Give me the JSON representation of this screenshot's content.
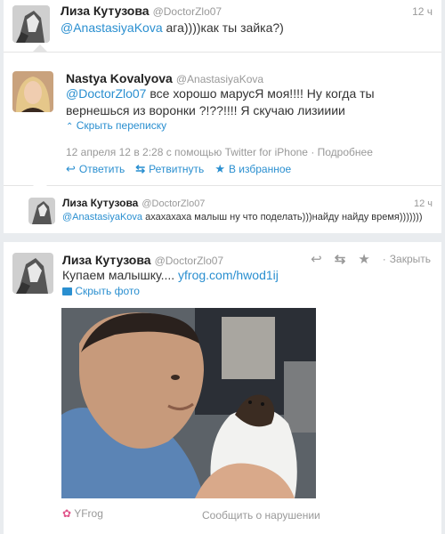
{
  "tweet1": {
    "name": "Лиза Кутузова",
    "handle": "@DoctorZlo07",
    "time": "12 ч",
    "mention": "@AnastasiyaKova",
    "text": " ага))))как ты зайка?)"
  },
  "tweet2": {
    "name": "Nastya Kovalyova",
    "handle": "@AnastasiyaKova",
    "mention": "@DoctorZlo07",
    "text": " все хорошо марусЯ моя!!!! Ну когда ты вернешься из воронки ?!??!!!! Я скучаю лизииии",
    "hide_conversation": "Скрыть переписку",
    "meta": "12 апреля 12 в 2:28 с помощью Twitter for iPhone · Подробнее",
    "reply": "Ответить",
    "retweet": "Ретвитнуть",
    "favorite": "В избранное"
  },
  "tweet3": {
    "name": "Лиза Кутузова",
    "handle": "@DoctorZlo07",
    "time": "12 ч",
    "mention": "@AnastasiyaKova",
    "text": " ахахахаха малыш ну что поделать)))найду найду время)))))))"
  },
  "tweet4": {
    "name": "Лиза Кутузова",
    "handle": "@DoctorZlo07",
    "close": "Закрыть",
    "text": "Купаем малышку.... ",
    "link": "yfrog.com/hwod1ij",
    "hide_photo": "Скрыть фото",
    "source": "YFrog",
    "report": "Сообщить о нарушении"
  }
}
